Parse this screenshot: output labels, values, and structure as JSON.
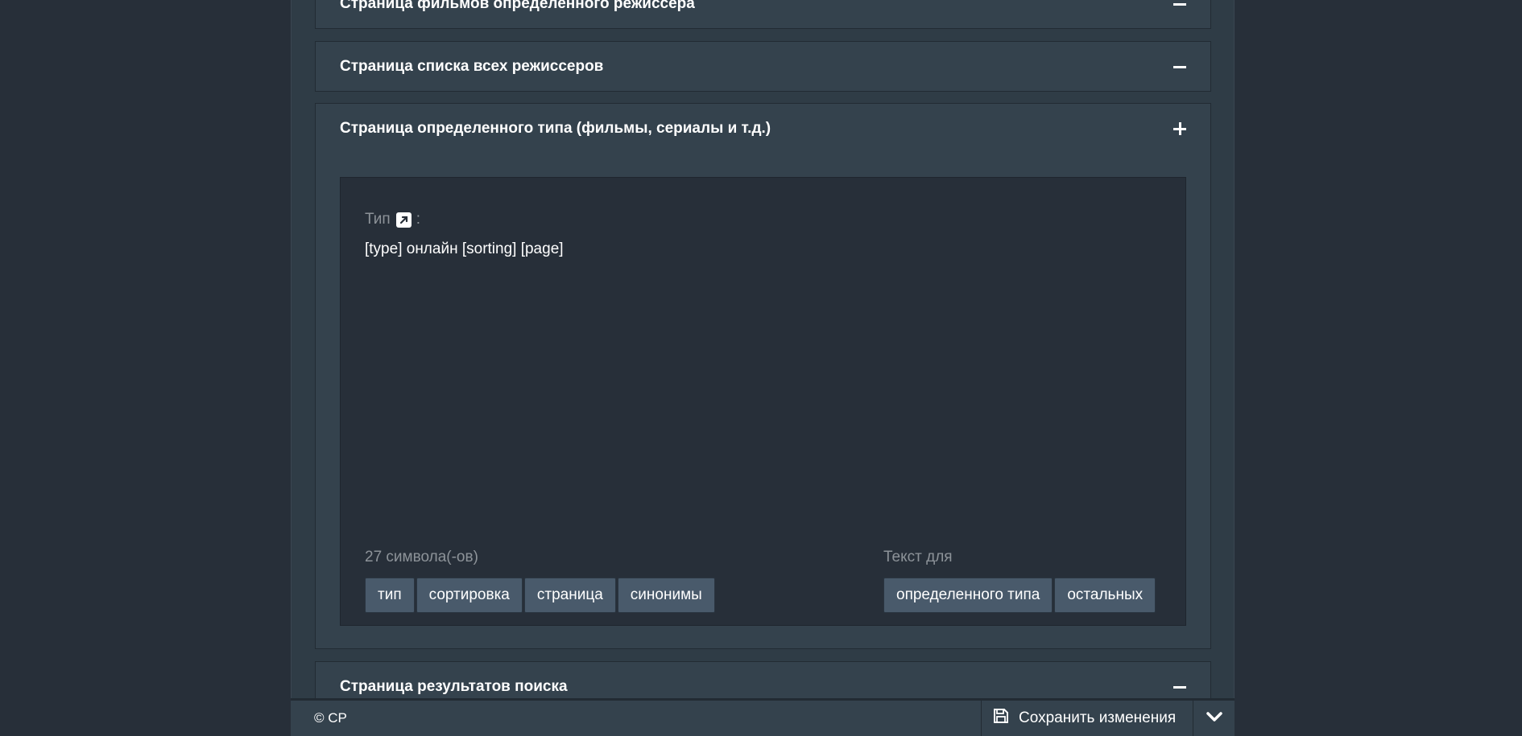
{
  "panels": {
    "p1": {
      "title": "Страница фильмов определенного режиссера"
    },
    "p2": {
      "title": "Страница списка всех режиссеров"
    },
    "p3": {
      "title": "Страница определенного типа (фильмы, сериалы и т.д.)",
      "field_label": "Тип",
      "field_label_suffix": ":",
      "field_value": "[type] онлайн [sorting] [page]",
      "counter": "27 символа(-ов)",
      "tokens": [
        "тип",
        "сортировка",
        "страница",
        "синонимы"
      ],
      "text_for_label": "Текст для",
      "text_for_options": [
        "определенного типа",
        "остальных"
      ]
    },
    "p4": {
      "title": "Страница результатов поиска"
    }
  },
  "footer": {
    "copyright": "© CP",
    "save_label": "Сохранить изменения"
  },
  "icons": {
    "collapse": "minus-icon",
    "expand": "plus-icon",
    "external": "external-link-icon",
    "save": "floppy-disk-icon",
    "more": "chevron-down-icon"
  }
}
